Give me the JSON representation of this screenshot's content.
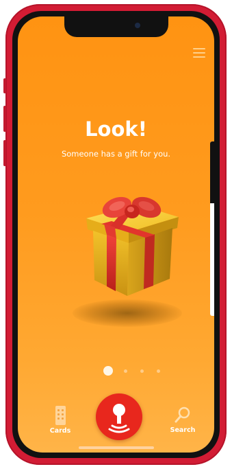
{
  "colors": {
    "device_frame": "#d21c34",
    "screen_top": "#ff9312",
    "screen_bottom": "#ffb448",
    "record_button": "#e8271d",
    "text": "#ffffff"
  },
  "header": {
    "menu_icon": "hamburger-menu-icon"
  },
  "hero": {
    "title": "Look!",
    "subtitle": "Someone has a gift for you.",
    "image_icon": "gift-box-icon"
  },
  "pager": {
    "count": 4,
    "active_index": 0
  },
  "tabbar": {
    "cards_label": "Cards",
    "cards_icon": "cards-icon",
    "record_icon": "record-microphone-icon",
    "search_label": "Search",
    "search_icon": "search-icon"
  }
}
